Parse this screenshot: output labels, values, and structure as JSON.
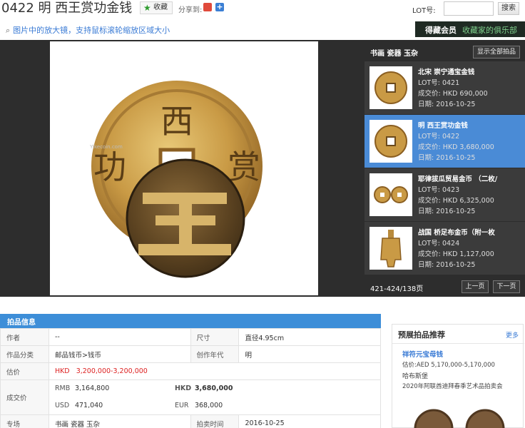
{
  "header": {
    "title": "0422 明 西王赏功金钱",
    "favorite_label": "收藏",
    "share_label": "分享到:",
    "lot_label": "LOT号:",
    "lot_input_value": "",
    "search_label": "搜索"
  },
  "zoom_tip": "图片中的放大镜，支持鼠标滚轮缩放区域大小",
  "club": {
    "primary": "得藏会员",
    "secondary": "收藏家的俱乐部"
  },
  "image": {
    "watermark": "Yikecoin.com"
  },
  "panel": {
    "category": "书画 瓷器 玉杂",
    "show_all": "显示全部拍品",
    "lots": [
      {
        "name": "北宋 崇宁通宝金钱",
        "lot_line": "LOT号: 0421",
        "price_line": "成交价: HKD 690,000",
        "date_line": "日期: 2016-10-25"
      },
      {
        "name": "明 西王赏功金钱",
        "lot_line": "LOT号: 0422",
        "price_line": "成交价: HKD 3,680,000",
        "date_line": "日期: 2016-10-25"
      },
      {
        "name": "耶律拔瓜贸易金币 （二枚/",
        "lot_line": "LOT号: 0423",
        "price_line": "成交价: HKD 6,325,000",
        "date_line": "日期: 2016-10-25"
      },
      {
        "name": "战国 桥足布金币（附一枚",
        "lot_line": "LOT号: 0424",
        "price_line": "成交价: HKD 1,127,000",
        "date_line": "日期: 2016-10-25"
      }
    ],
    "pager_count": "421-424/138页",
    "prev": "上一页",
    "next": "下一页"
  },
  "info": {
    "heading": "拍品信息",
    "author_k": "作者",
    "author_v": "--",
    "size_k": "尺寸",
    "size_v": "直径4.95cm",
    "category_k": "作品分类",
    "category_v": "邮品钱币>钱币",
    "era_k": "创作年代",
    "era_v": "明",
    "estimate_k": "估价",
    "estimate_cur": "HKD",
    "estimate_v": "3,200,000-3,200,000",
    "price_k": "成交价",
    "rmb_k": "RMB",
    "rmb_v": "3,164,800",
    "hkd_k": "HKD",
    "hkd_v": "3,680,000",
    "usd_k": "USD",
    "usd_v": "471,040",
    "eur_k": "EUR",
    "eur_v": "368,000",
    "session_k": "专场",
    "session_v": "书画 瓷器 玉杂",
    "time_k": "拍卖时间",
    "time_v": "2016-10-25"
  },
  "recommend": {
    "title": "预展拍品推荐",
    "more": "更多",
    "name": "祥符元宝母钱",
    "estimate": "估价:AED 5,170,000-5,170,000",
    "house": "哈布斯堡",
    "sale": "2020年阿联酋迪拜春季艺术品拍卖会"
  },
  "colors": {
    "accent": "#3d8ed8",
    "active_row": "#4a8bd6",
    "dark_bg": "#2d2d2d",
    "price_red": "#dd2222"
  }
}
